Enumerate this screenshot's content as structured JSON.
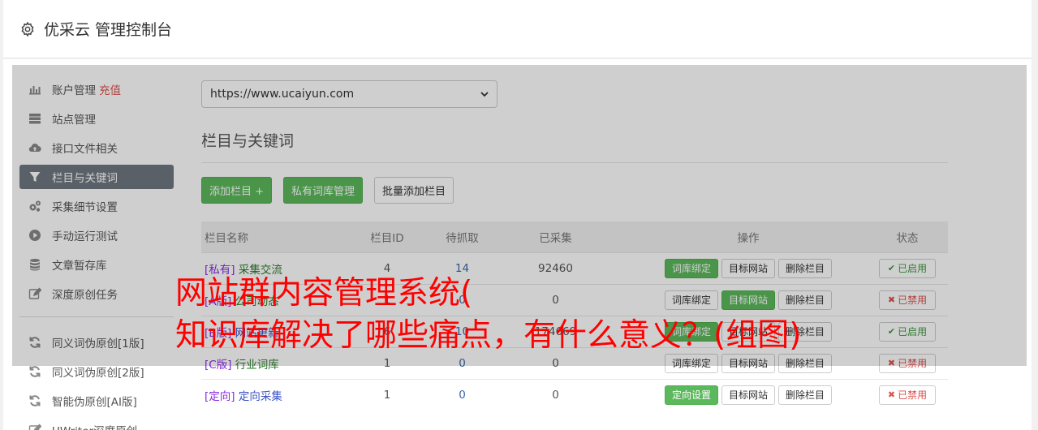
{
  "app": {
    "title": "优采云 管理控制台"
  },
  "sidebar": {
    "items": [
      {
        "label": "账户管理",
        "extra": "充值",
        "icon": "bar-chart-icon",
        "active": false
      },
      {
        "label": "站点管理",
        "icon": "server-icon",
        "active": false
      },
      {
        "label": "接口文件相关",
        "icon": "cloud-upload-icon",
        "active": false
      },
      {
        "label": "栏目与关键词",
        "icon": "filter-icon",
        "active": true
      },
      {
        "label": "采集细节设置",
        "icon": "cogs-icon",
        "active": false
      },
      {
        "label": "手动运行测试",
        "icon": "play-circle-icon",
        "active": false
      },
      {
        "label": "文章暂存库",
        "icon": "database-icon",
        "active": false
      },
      {
        "label": "深度原创任务",
        "icon": "edit-icon",
        "active": false
      }
    ],
    "tools": [
      {
        "label": "同义词伪原创[1版]",
        "icon": "refresh-icon"
      },
      {
        "label": "同义词伪原创[2版]",
        "icon": "refresh-icon"
      },
      {
        "label": "智能伪原创[AI版]",
        "icon": "refresh-icon"
      },
      {
        "label": "UWriter深度原创",
        "icon": "edit-icon"
      }
    ]
  },
  "main": {
    "site_select": "https://www.ucaiyun.com",
    "section_title": "栏目与关键词",
    "toolbar": {
      "add_column": "添加栏目 +",
      "private_lexicon": "私有词库管理",
      "batch_add": "批量添加栏目"
    },
    "table": {
      "headers": {
        "name": "栏目名称",
        "id": "栏目ID",
        "pending": "待抓取",
        "collected": "已采集",
        "ops": "操作",
        "status": "状态"
      },
      "rows": [
        {
          "tag": "[私有]",
          "name": "采集交流",
          "id": "4",
          "pending": "14",
          "collected": "92460",
          "op1": "词库绑定",
          "op1_active": true,
          "op2": "目标网站",
          "op2_active": false,
          "op3": "删除栏目",
          "status": "已启用",
          "enabled": true,
          "link_color": "green"
        },
        {
          "tag": "[A版]",
          "name": "公司动态",
          "id": "1",
          "pending": "0",
          "collected": "0",
          "op1": "词库绑定",
          "op1_active": false,
          "op2": "目标网站",
          "op2_active": true,
          "op3": "删除栏目",
          "status": "已禁用",
          "enabled": false,
          "link_color": "green"
        },
        {
          "tag": "[B版]",
          "name": "网站更新",
          "id": "6",
          "pending": "10",
          "collected": "174669",
          "op1": "词库绑定",
          "op1_active": true,
          "op2": "目标网站",
          "op2_active": false,
          "op3": "删除栏目",
          "status": "已启用",
          "enabled": true,
          "link_color": "blue"
        },
        {
          "tag": "[C版]",
          "name": "行业词库",
          "id": "1",
          "pending": "0",
          "collected": "0",
          "op1": "词库绑定",
          "op1_active": false,
          "op2": "目标网站",
          "op2_active": false,
          "op3": "删除栏目",
          "status": "已禁用",
          "enabled": false,
          "link_color": "green"
        },
        {
          "tag": "[定向]",
          "name": "定向采集",
          "id": "1",
          "pending": "0",
          "collected": "0",
          "op1": "定向设置",
          "op1_active": true,
          "op2": "目标网站",
          "op2_active": false,
          "op3": "删除栏目",
          "status": "已禁用",
          "enabled": false,
          "link_color": "blue"
        }
      ]
    }
  },
  "watermark": {
    "line1": "网站群内容管理系统(",
    "line2": "知识库解决了哪些痛点，有什么意义？(组图)"
  },
  "colors": {
    "accent_green": "#5cb85c",
    "danger_red": "#d9534f",
    "active_nav": "#6f7780",
    "watermark": "#ff0000"
  }
}
